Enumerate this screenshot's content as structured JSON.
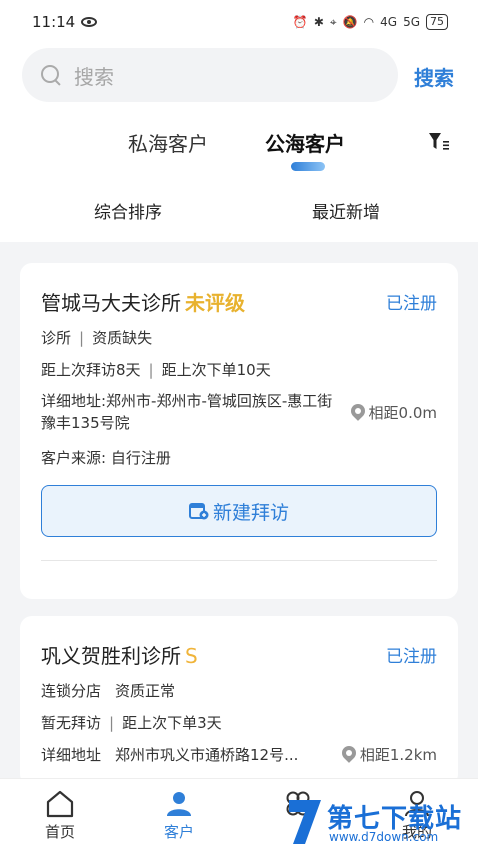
{
  "status_bar": {
    "time": "11:14",
    "battery": "75",
    "signal_1": "4G",
    "signal_2": "5G"
  },
  "search": {
    "placeholder": "搜索",
    "button_label": "搜索"
  },
  "tabs": [
    {
      "label": "私海客户"
    },
    {
      "label": "公海客户"
    }
  ],
  "sort": {
    "overall": "综合排序",
    "recent": "最近新增"
  },
  "cards": [
    {
      "name": "管城马大夫诊所",
      "grade": "未评级",
      "status": "已注册",
      "type": "诊所",
      "qualification": "资质缺失",
      "last_visit": "距上次拜访8天",
      "last_order": "距上次下单10天",
      "address": "详细地址:郑州市-郑州市-管城回族区-惠工街豫丰135号院",
      "distance": "相距0.0m",
      "source": "客户来源: 自行注册",
      "action": "新建拜访"
    },
    {
      "name": "巩义贺胜利诊所",
      "grade": "S",
      "status": "已注册",
      "type": "连锁分店",
      "qualification": "资质正常",
      "last_visit": "暂无拜访",
      "last_order": "距上次下单3天",
      "address_label": "详细地址",
      "address": "郑州市巩义市通桥路12号...",
      "distance": "相距1.2km"
    }
  ],
  "nav": [
    {
      "label": "首页",
      "icon": "home-icon"
    },
    {
      "label": "客户",
      "icon": "customer-icon"
    },
    {
      "label": "",
      "icon": "clover-icon"
    },
    {
      "label": "我的",
      "icon": "profile-icon"
    }
  ],
  "watermark": {
    "title": "第七下载站",
    "url": "www.d7down.com"
  },
  "colors": {
    "accent": "#2f7fd8",
    "grade_gold": "#e8b22f"
  }
}
